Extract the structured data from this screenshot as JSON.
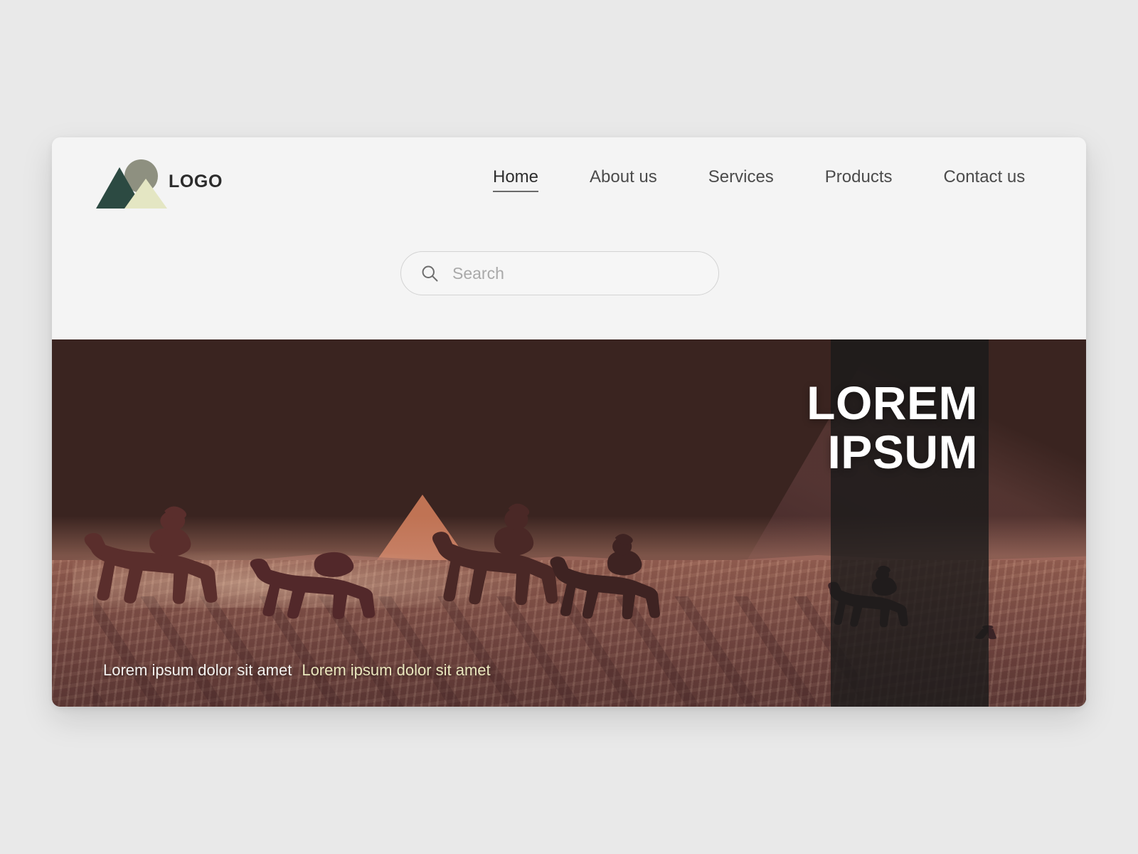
{
  "page": {
    "background_color": "#e9e9e9"
  },
  "card": {
    "background_color": "#f4f4f4"
  },
  "header": {
    "logo": {
      "text": "LOGO",
      "icon_name": "mountain-circle-logo",
      "colors": {
        "triangle_dark": "#2c4a42",
        "triangle_light": "#e4e6c3",
        "circle": "#8e9080"
      }
    },
    "nav": {
      "items": [
        {
          "label": "Home",
          "active": true
        },
        {
          "label": "About us",
          "active": false
        },
        {
          "label": "Services",
          "active": false
        },
        {
          "label": "Products",
          "active": false
        },
        {
          "label": "Contact us",
          "active": false
        }
      ]
    },
    "search": {
      "icon_name": "search-icon",
      "placeholder": "Search",
      "value": ""
    }
  },
  "hero": {
    "image_alt": "camel caravan riders at sunset with pyramid in desert",
    "title_line_1": "LOREM",
    "title_line_2": "IPSUM",
    "title_color": "#ffffff",
    "overlay_color": "rgba(26,26,26,0.80)",
    "captions": [
      {
        "text": "Lorem ipsum dolor sit amet",
        "color": "#f3f1ee"
      },
      {
        "text": "Lorem ipsum dolor sit amet",
        "color": "#e9e6bd"
      }
    ]
  }
}
